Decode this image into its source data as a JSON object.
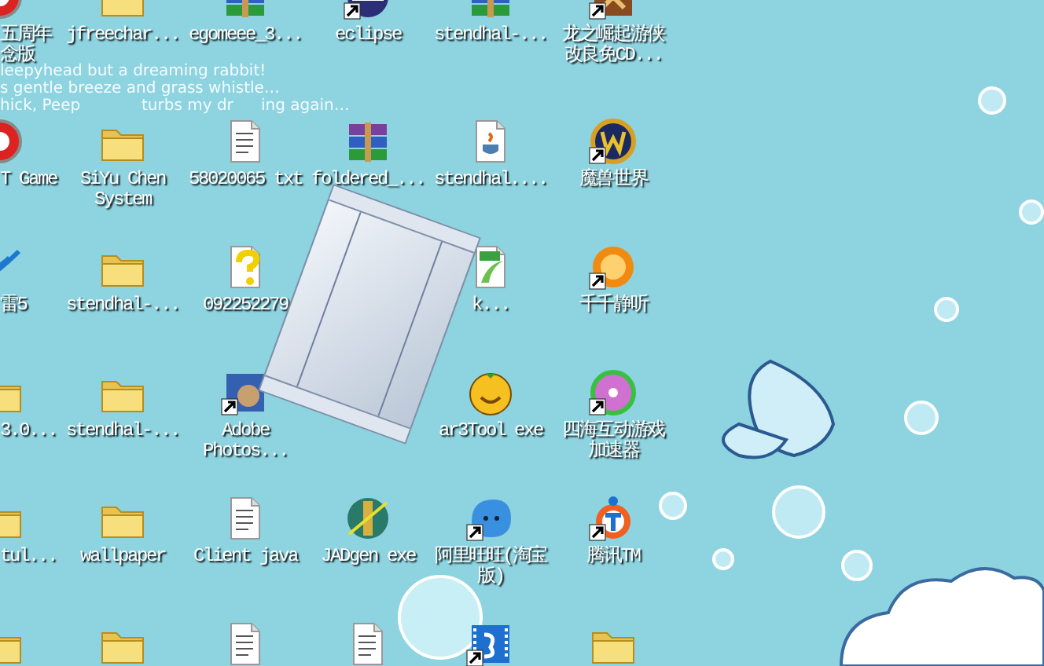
{
  "wallpaper_lines": [
    [
      "leepyhead but a dreaming rabbit!"
    ],
    [
      "s gentle breeze and grass whistle…"
    ],
    [
      "hick, Peep",
      "turbs my dr",
      "ing again…"
    ]
  ],
  "desktop_rows": [
    [
      {
        "kind": "game",
        "label": "五周年念版"
      },
      {
        "kind": "folder",
        "label": "jfreechar...",
        "shortcut": false
      },
      {
        "kind": "rar",
        "label": "egomeee_3...",
        "shortcut": false
      },
      {
        "kind": "eclipse",
        "label": "eclipse",
        "shortcut": true
      },
      {
        "kind": "rar",
        "label": "stendhal-...",
        "shortcut": false
      },
      {
        "kind": "dragon",
        "label": "龙之崛起游侠改良免CD...",
        "shortcut": true
      }
    ],
    [
      {
        "kind": "game",
        "label": "T Game"
      },
      {
        "kind": "folder",
        "label": "SiYu Chen\nSystem",
        "shortcut": false
      },
      {
        "kind": "notepad",
        "label": "58020065 txt",
        "shortcut": false
      },
      {
        "kind": "rar",
        "label": "foldered_...",
        "shortcut": false
      },
      {
        "kind": "java",
        "label": "stendhal....",
        "shortcut": false
      },
      {
        "kind": "wow",
        "label": "魔兽世界",
        "shortcut": true
      }
    ],
    [
      {
        "kind": "lightning",
        "label": "雷5"
      },
      {
        "kind": "folder",
        "label": "stendhal-...",
        "shortcut": false
      },
      {
        "kind": "help",
        "label": "092252279",
        "shortcut": false
      },
      null,
      {
        "kind": "bt",
        "label": "k...",
        "shortcut": false
      },
      {
        "kind": "player",
        "label": "千千静听",
        "shortcut": true
      }
    ],
    [
      {
        "kind": "folder",
        "label": "3.0..."
      },
      {
        "kind": "folder",
        "label": "stendhal-...",
        "shortcut": false
      },
      {
        "kind": "photoshop",
        "label": "Adobe\nPhotos...",
        "shortcut": true
      },
      null,
      {
        "kind": "smiley",
        "label": "ar3Tool exe",
        "shortcut": false
      },
      {
        "kind": "disc",
        "label": "四海互动游戏加速器",
        "shortcut": true
      }
    ],
    [
      {
        "kind": "folder",
        "label": "tul..."
      },
      {
        "kind": "folder",
        "label": "wallpaper",
        "shortcut": false
      },
      {
        "kind": "notepad",
        "label": "Client java",
        "shortcut": false
      },
      {
        "kind": "jad",
        "label": "JADgen exe",
        "shortcut": false
      },
      {
        "kind": "chat",
        "label": "阿里旺旺(淘宝版)",
        "shortcut": true
      },
      {
        "kind": "tm",
        "label": "腾讯TM",
        "shortcut": true
      }
    ],
    [
      {
        "kind": "folder"
      },
      {
        "kind": "folder",
        "shortcut": false
      },
      {
        "kind": "notepad",
        "shortcut": false
      },
      {
        "kind": "notepad",
        "shortcut": false
      },
      {
        "kind": "video",
        "shortcut": true
      },
      {
        "kind": "folder",
        "shortcut": false
      }
    ]
  ]
}
